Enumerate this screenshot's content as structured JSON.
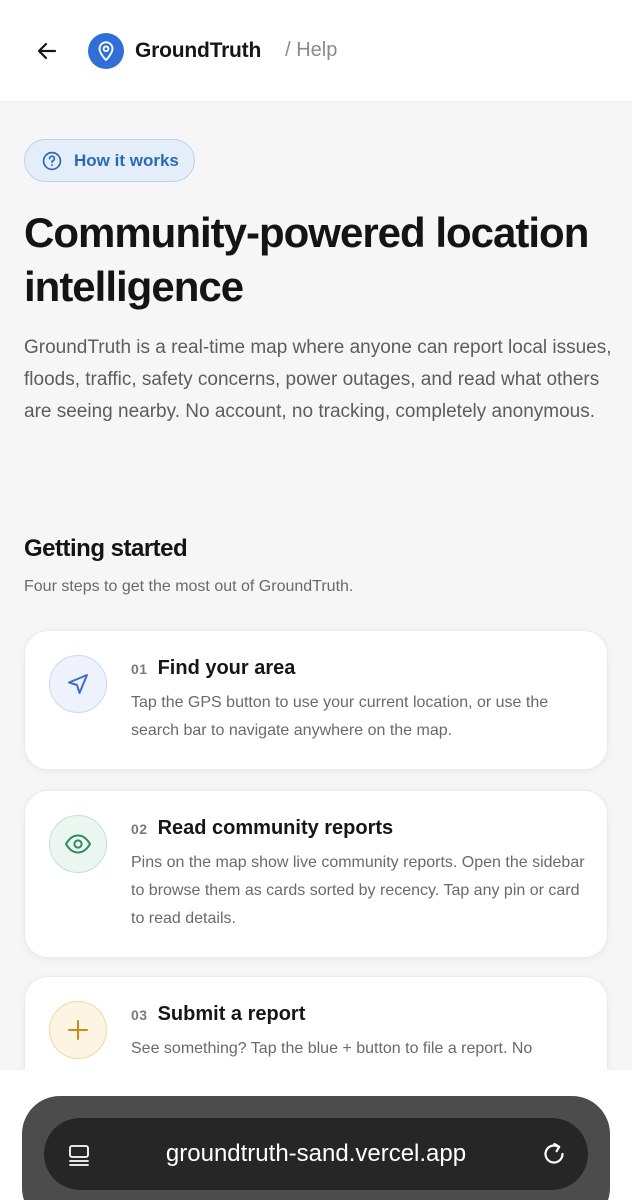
{
  "header": {
    "brand": "GroundTruth",
    "breadcrumb": "/ Help",
    "icons": {
      "back": "arrow-left-icon",
      "logo": "map-pin-icon"
    },
    "colors": {
      "logo_bg": "#2f6fd6"
    }
  },
  "badge": {
    "label": "How it works",
    "icon": "question-circle-icon",
    "color": "#2d68b8"
  },
  "hero": {
    "title": "Community-powered location intelligence",
    "description": "GroundTruth is a real-time map where anyone can report local issues, floods, traffic, safety concerns, power outages, and read what others are seeing nearby. No account, no tracking, completely anonymous."
  },
  "getting_started": {
    "title": "Getting started",
    "subtitle": "Four steps to get the most out of GroundTruth.",
    "steps": [
      {
        "number": "01",
        "title": "Find your area",
        "description": "Tap the GPS button to use your current location, or use the search bar to navigate anywhere on the map.",
        "icon": "navigation-arrow-icon",
        "accent": "#3d6fc9"
      },
      {
        "number": "02",
        "title": "Read community reports",
        "description": "Pins on the map show live community reports. Open the sidebar to browse them as cards sorted by recency. Tap any pin or card to read details.",
        "icon": "eye-icon",
        "accent": "#2f8a62"
      },
      {
        "number": "03",
        "title": "Submit a report",
        "description": "See something? Tap the blue + button to file a report. No",
        "icon": "plus-icon",
        "accent": "#cf8a16"
      }
    ]
  },
  "browser": {
    "url": "groundtruth-sand.vercel.app",
    "icons": {
      "left": "tabs-icon",
      "right": "reload-icon"
    }
  }
}
